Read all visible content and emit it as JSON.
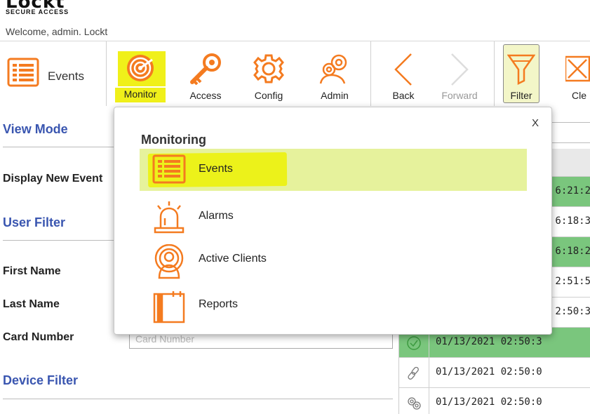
{
  "header": {
    "logo_text": "Lockt",
    "tagline": "SECURE ACCESS",
    "welcome": "Welcome, admin.  Lockt"
  },
  "toolbar": {
    "current_section": "Events",
    "buttons": [
      {
        "label": "Monitor",
        "icon": "radar-icon"
      },
      {
        "label": "Access",
        "icon": "key-icon"
      },
      {
        "label": "Config",
        "icon": "gear-icon"
      },
      {
        "label": "Admin",
        "icon": "gears-icon"
      },
      {
        "label": "Back",
        "icon": "chevron-left-icon"
      },
      {
        "label": "Forward",
        "icon": "chevron-right-icon"
      },
      {
        "label": "Filter",
        "icon": "funnel-icon"
      },
      {
        "label": "Cle",
        "icon": "clear-icon"
      }
    ]
  },
  "filter_panel": {
    "view_mode": "View Mode",
    "display_new_events": "Display New Event",
    "user_filter": "User Filter",
    "first_name": "First Name",
    "last_name": "Last Name",
    "card_number": "Card Number",
    "card_number_placeholder": "Card Number",
    "device_filter": "Device Filter"
  },
  "events_grid": {
    "rows": [
      {
        "time": "6:21:2",
        "status": "granted",
        "icon": "check-icon"
      },
      {
        "time": "6:18:3",
        "status": "neutral",
        "icon": "link-icon"
      },
      {
        "time": "6:18:2",
        "status": "granted",
        "icon": "check-icon"
      },
      {
        "time": "2:51:5",
        "status": "neutral",
        "icon": "link-icon"
      },
      {
        "time": "2:50:3",
        "status": "neutral",
        "icon": "link-icon"
      },
      {
        "time": "01/13/2021 02:50:3",
        "status": "granted",
        "icon": "check-icon"
      },
      {
        "time": "01/13/2021 02:50:0",
        "status": "neutral",
        "icon": "link-icon"
      },
      {
        "time": "01/13/2021 02:50:0",
        "status": "neutral",
        "icon": "gears-icon"
      }
    ]
  },
  "monitoring_menu": {
    "title": "Monitoring",
    "close": "X",
    "items": [
      {
        "label": "Events",
        "icon": "list-icon",
        "active": true
      },
      {
        "label": "Alarms",
        "icon": "alarm-light-icon",
        "active": false
      },
      {
        "label": "Active Clients",
        "icon": "user-signal-icon",
        "active": false
      },
      {
        "label": "Reports",
        "icon": "report-icon",
        "active": false
      }
    ]
  },
  "colors": {
    "accent_orange": "#f47b20",
    "heading_blue": "#3a56b0",
    "highlight_yellow": "#f0f01a",
    "granted_green": "#7ac67d"
  }
}
